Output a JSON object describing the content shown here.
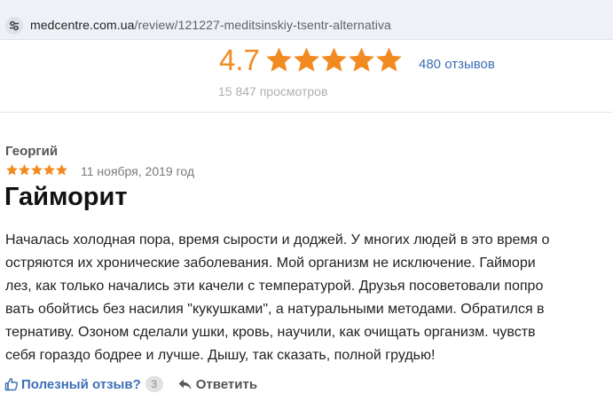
{
  "browser": {
    "url_domain": "medcentre.com.ua",
    "url_path": "/review/121227-meditsinskiy-tsentr-alternativa",
    "site_icon": "tune-icon"
  },
  "rating": {
    "score": "4.7",
    "stars": 5,
    "reviews_link": "480 отзывов",
    "views": "15 847 просмотров",
    "star_color": "#f28a22"
  },
  "review": {
    "author": "Георгий",
    "stars": 5,
    "date": "11 ноября, 2019 год",
    "title": "Гайморит",
    "body_lines": [
      "Началась холодная пора, время сырости и доджей. У многих людей в это время о",
      "остряются их хронические заболевания. Мой организм не исключение. Гаймори",
      "лез, как только начались эти качели с температурой. Друзья посоветовали попро",
      "вать обойтись без насилия \"кукушками\", а натуральными методами. Обратился в",
      "тернативу. Озоном сделали ушки, кровь, научили, как очищать организм. чувств",
      "себя гораздо бодрее и лучше. Дышу, так сказать, полной грудью!"
    ]
  },
  "actions": {
    "helpful_label": "Полезный отзыв?",
    "helpful_count": "3",
    "reply_label": "Ответить",
    "link_color": "#3b6fb6"
  }
}
